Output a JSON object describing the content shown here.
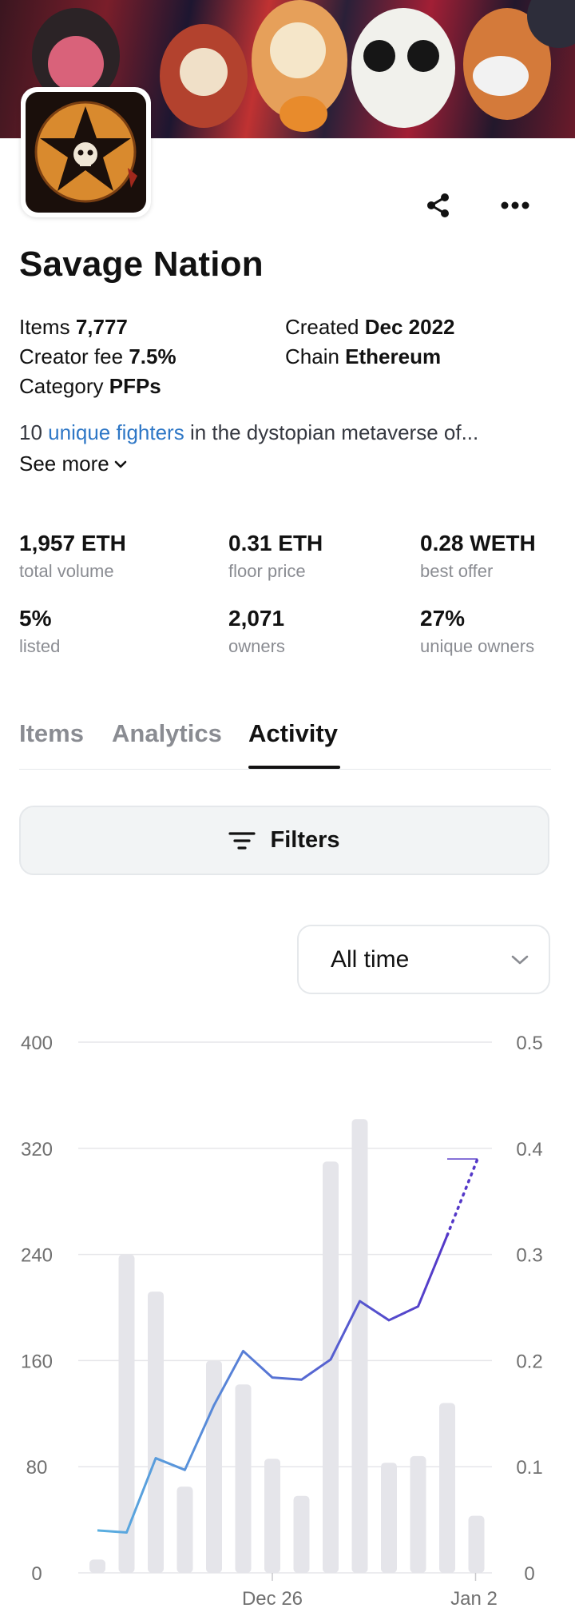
{
  "collection": {
    "name": "Savage Nation",
    "details": [
      {
        "label": "Items",
        "value": "7,777"
      },
      {
        "label": "Created",
        "value": "Dec 2022"
      },
      {
        "label": "Creator fee",
        "value": "7.5%"
      },
      {
        "label": "Chain",
        "value": "Ethereum"
      },
      {
        "label": "Category",
        "value": "PFPs"
      }
    ],
    "description": {
      "before": "10 ",
      "link": "unique fighters",
      "after": " in the dystopian metaverse of..."
    },
    "see_more": "See more"
  },
  "stats": [
    {
      "value": "1,957 ETH",
      "label": "total volume"
    },
    {
      "value": "0.31 ETH",
      "label": "floor price"
    },
    {
      "value": "0.28 WETH",
      "label": "best offer"
    },
    {
      "value": "5%",
      "label": "listed"
    },
    {
      "value": "2,071",
      "label": "owners"
    },
    {
      "value": "27%",
      "label": "unique owners"
    }
  ],
  "tabs": [
    {
      "label": "Items",
      "active": false
    },
    {
      "label": "Analytics",
      "active": false
    },
    {
      "label": "Activity",
      "active": true
    }
  ],
  "filters_label": "Filters",
  "time_range": {
    "selected": "All time"
  },
  "icons": {
    "share": "share-icon",
    "more": "more-horizontal-icon",
    "chevron": "chevron-down-icon",
    "filter": "filter-lines-icon"
  },
  "colors": {
    "link": "#2e77c6",
    "bar": "#e5e5ea",
    "line_start": "#5ab0e0",
    "line_end": "#5438c8"
  },
  "chart_data": {
    "type": "bar+line",
    "left_axis": {
      "ticks": [
        "400",
        "320",
        "240",
        "160",
        "80",
        "0"
      ],
      "range": [
        0,
        400
      ]
    },
    "right_axis": {
      "ticks": [
        "0.5",
        "0.4",
        "0.3",
        "0.2",
        "0.1",
        "0"
      ],
      "range": [
        0,
        0.5
      ]
    },
    "x_labels": [
      {
        "label": "Dec 26",
        "index": 6
      },
      {
        "label": "Jan 2",
        "index": 13
      }
    ],
    "volume_bars": [
      10,
      240,
      212,
      65,
      160,
      142,
      86,
      58,
      310,
      342,
      83,
      88,
      128,
      43
    ],
    "price_line": [
      0.04,
      0.038,
      0.108,
      0.097,
      0.158,
      0.209,
      0.184,
      0.182,
      0.201,
      0.256,
      0.238,
      0.251,
      0.318
    ],
    "price_projection": [
      0.318,
      0.39
    ],
    "grid": true
  }
}
